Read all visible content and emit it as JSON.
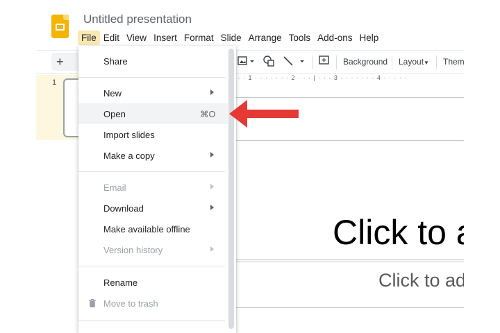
{
  "app": {
    "title": "Untitled presentation",
    "logo_icon": "google-slides-logo"
  },
  "menubar": {
    "items": [
      {
        "label": "File",
        "active": true
      },
      {
        "label": "Edit"
      },
      {
        "label": "View"
      },
      {
        "label": "Insert"
      },
      {
        "label": "Format"
      },
      {
        "label": "Slide"
      },
      {
        "label": "Arrange"
      },
      {
        "label": "Tools"
      },
      {
        "label": "Add-ons"
      },
      {
        "label": "Help"
      }
    ]
  },
  "toolbar": {
    "add_label": "+",
    "background_label": "Background",
    "layout_label": "Layout",
    "theme_label": "Theme"
  },
  "ruler": {
    "marks": [
      "1",
      "2",
      "3",
      "4"
    ]
  },
  "filmstrip": {
    "slide_number": "1"
  },
  "slide": {
    "title_placeholder": "Click to add title",
    "subtitle_placeholder": "Click to add subtitle"
  },
  "file_menu": {
    "share": "Share",
    "new": "New",
    "open": "Open",
    "open_shortcut": "⌘O",
    "import_slides": "Import slides",
    "make_copy": "Make a copy",
    "email": "Email",
    "download": "Download",
    "make_offline": "Make available offline",
    "version_history": "Version history",
    "rename": "Rename",
    "move_to_trash": "Move to trash"
  },
  "colors": {
    "accent_yellow": "#f4b400",
    "menu_active_bg": "#fce8b2",
    "arrow_red": "#e53935"
  }
}
